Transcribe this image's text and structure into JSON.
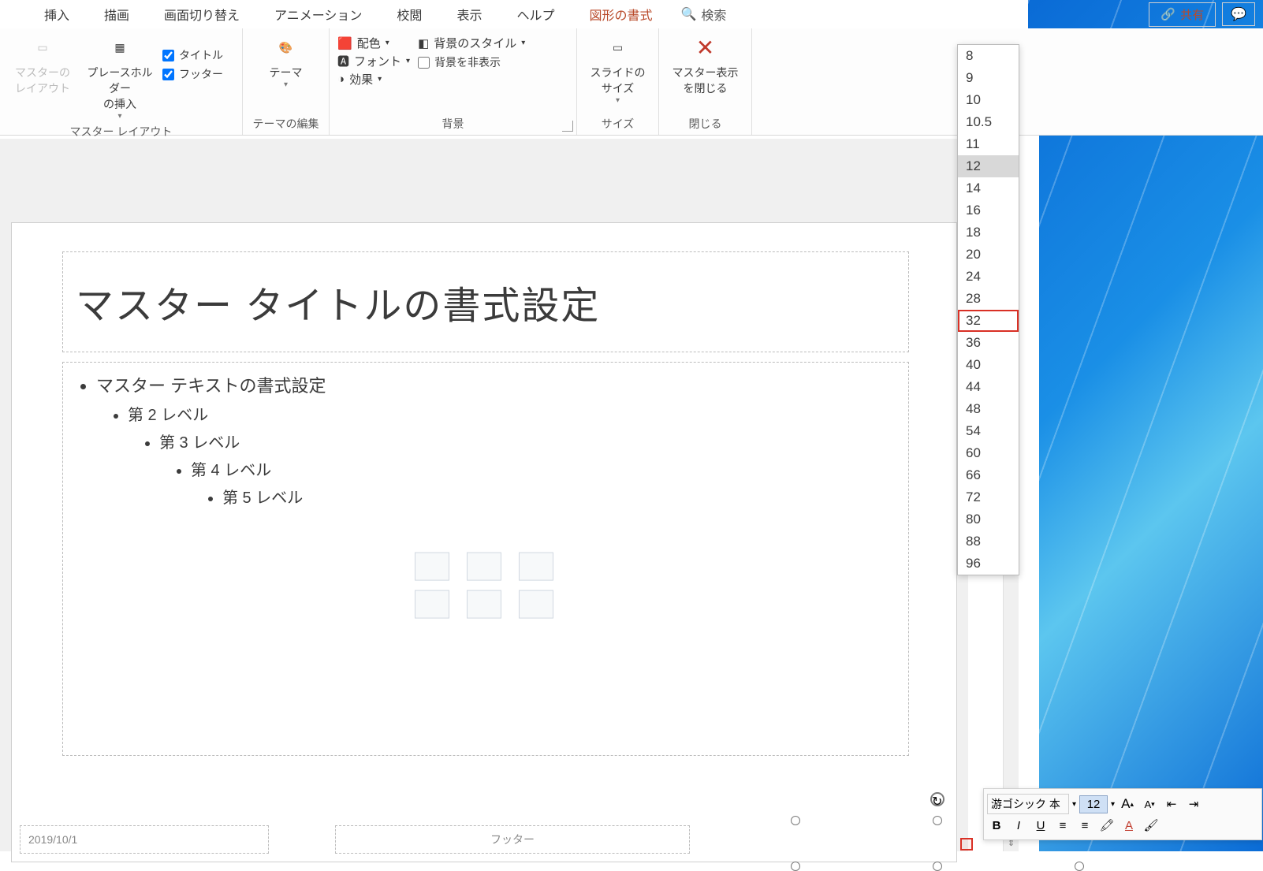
{
  "menubar": {
    "items": [
      "挿入",
      "描画",
      "画面切り替え",
      "アニメーション",
      "校閲",
      "表示",
      "ヘルプ",
      "図形の書式"
    ],
    "active_index": 7,
    "search_label": "検索",
    "share_label": "共有"
  },
  "ribbon": {
    "groups": {
      "master_layout": {
        "label": "マスター レイアウト",
        "master_layout_btn": "マスターの\nレイアウト",
        "placeholder_btn": "プレースホルダー\nの挿入",
        "chk_title": "タイトル",
        "chk_footer": "フッター"
      },
      "theme_edit": {
        "label": "テーマの編集",
        "theme_btn": "テーマ"
      },
      "background": {
        "label": "背景",
        "colors": "配色",
        "fonts": "フォント",
        "effects": "効果",
        "bg_styles": "背景のスタイル",
        "hide_bg": "背景を非表示"
      },
      "size": {
        "label": "サイズ",
        "slide_size": "スライドの\nサイズ"
      },
      "close": {
        "label": "閉じる",
        "close_master": "マスター表示\nを閉じる"
      }
    }
  },
  "slide": {
    "title_placeholder": "マスター タイトルの書式設定",
    "body_levels": [
      "マスター テキストの書式設定",
      "第 2 レベル",
      "第 3 レベル",
      "第 4 レベル",
      "第 5 レベル"
    ],
    "date": "2019/10/1",
    "footer": "フッター",
    "number": "‹#›"
  },
  "mini_toolbar": {
    "font_name": "游ゴシック 本",
    "font_size": "12",
    "buttons": {
      "increase": "A",
      "decrease": "A",
      "dec_indent": "",
      "inc_indent": "",
      "bold": "B",
      "italic": "I",
      "underline": "U",
      "align_l": "",
      "align_c": "",
      "align_r": "",
      "highlight": "",
      "font_color": "A",
      "format_painter": ""
    }
  },
  "font_size_list": {
    "options": [
      "8",
      "9",
      "10",
      "10.5",
      "11",
      "12",
      "14",
      "16",
      "18",
      "20",
      "24",
      "28",
      "32",
      "36",
      "40",
      "44",
      "48",
      "54",
      "60",
      "66",
      "72",
      "80",
      "88",
      "96"
    ],
    "highlighted": "12",
    "red_framed": "32"
  }
}
